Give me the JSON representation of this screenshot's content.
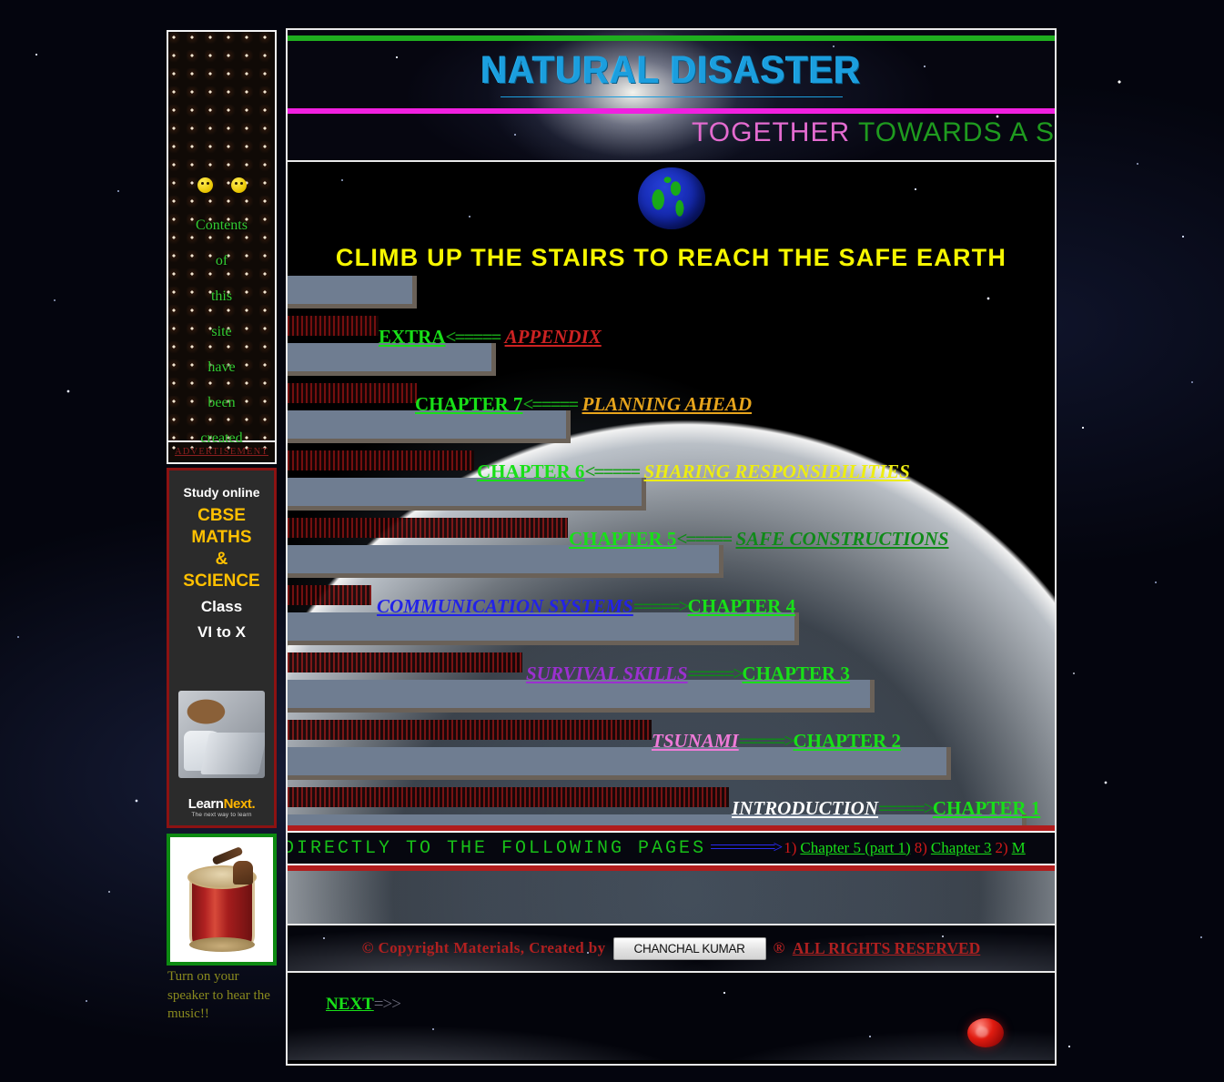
{
  "site": {
    "title": "NATURAL DISASTER",
    "tagline_part1": "TOGETHER ",
    "tagline_part2": "TOWARDS A S"
  },
  "sidebar": {
    "contents_words": [
      "Contents",
      "of",
      "this",
      "site",
      "have",
      "been",
      "created"
    ],
    "advertisement_label": "ADVERTISEMENT",
    "ad": {
      "line1": "Study online",
      "line2a": "CBSE",
      "line2b": "MATHS",
      "line2c": "&",
      "line2d": "SCIENCE",
      "line3a": "Class",
      "line3b": "VI to X",
      "brand": "LearnNext",
      "brand_prefix": "Learn",
      "brand_suffix": "Next.",
      "brand_tagline": "The next way to learn"
    },
    "music_note": "Turn on your speaker to hear the music!!"
  },
  "main": {
    "heading": "CLIMB UP THE STAIRS TO REACH THE SAFE EARTH",
    "steps": [
      {
        "left_label": "EXTRA",
        "left_color": "c-green",
        "arrow": "<=====",
        "right_label": "APPENDIX",
        "right_color": "c-red",
        "direction": "left"
      },
      {
        "left_label": "CHAPTER 7",
        "left_color": "c-green",
        "arrow": "<=====",
        "right_label": "PLANNING AHEAD",
        "right_color": "c-orange",
        "direction": "left"
      },
      {
        "left_label": "CHAPTER 6",
        "left_color": "c-green",
        "arrow": "<=====",
        "right_label": "SHARING RESPONSIBILITIES",
        "right_color": "c-yellow",
        "direction": "left"
      },
      {
        "left_label": "CHAPTER 5",
        "left_color": "c-green",
        "arrow": "<=====",
        "right_label": "SAFE CONSTRUCTIONS",
        "right_color": "c-dgreen",
        "direction": "left"
      },
      {
        "left_label": "COMMUNICATION SYSTEMS",
        "left_color": "c-blue",
        "arrow": "=====>",
        "right_label": "CHAPTER 4",
        "right_color": "c-green",
        "direction": "right"
      },
      {
        "left_label": "SURVIVAL SKILLS",
        "left_color": "c-purple",
        "arrow": "=====>",
        "right_label": "CHAPTER 3",
        "right_color": "c-green",
        "direction": "right"
      },
      {
        "left_label": "TSUNAMI",
        "left_color": "c-pink",
        "arrow": "=====>",
        "right_label": "CHAPTER 2",
        "right_color": "c-green",
        "direction": "right"
      },
      {
        "left_label": "INTRODUCTION",
        "left_color": "c-white",
        "arrow": "=====>",
        "right_label": "CHAPTER 1",
        "right_color": "c-green",
        "direction": "right"
      }
    ],
    "jump": {
      "label": "P  DIRECTLY  TO  THE  FOLLOWING  PAGES",
      "arrow": "=========>",
      "links": [
        {
          "num": "1)",
          "text": "Chapter 5  (part 1)"
        },
        {
          "num": "8)",
          "text": "Chapter 3"
        },
        {
          "num": "2)",
          "text": "M"
        }
      ]
    },
    "footer": {
      "copyright": "©  Copyright Materials,  Created by",
      "author_button": "CHANCHAL KUMAR",
      "registered_mark": "®",
      "rights": "ALL RIGHTS RESERVED"
    },
    "next": {
      "label": "NEXT",
      "arrow": "=>>"
    }
  }
}
